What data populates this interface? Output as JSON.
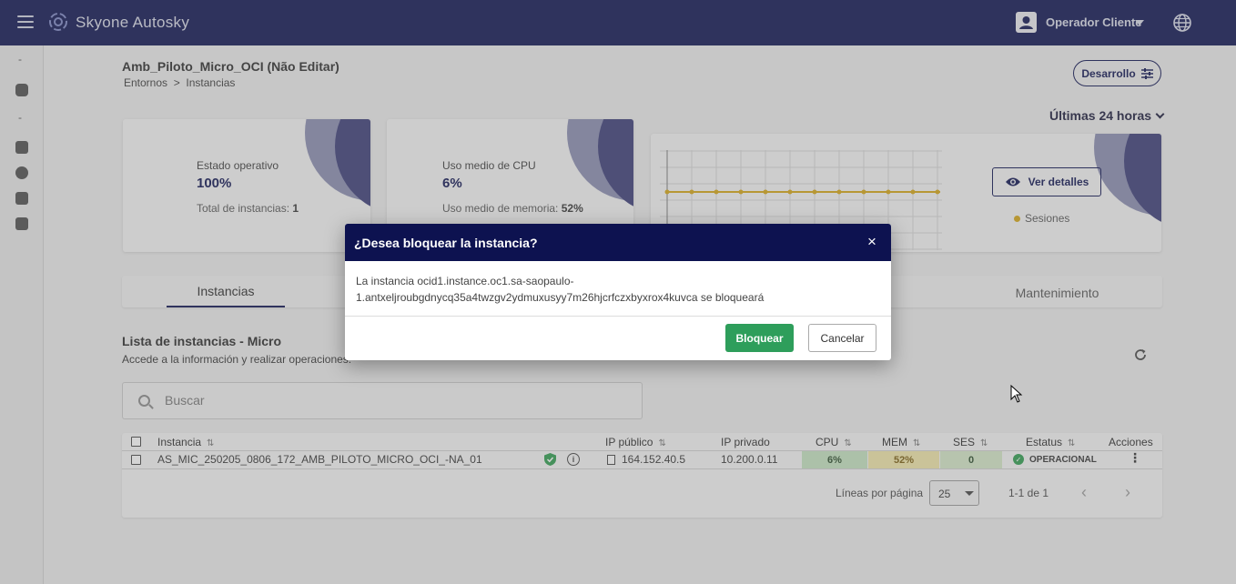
{
  "app": {
    "title": "Skyone Autosky",
    "user_name": "Operador Cliente"
  },
  "page": {
    "title": "Amb_Piloto_Micro_OCI (Não Editar)",
    "breadcrumb": "Entornos  >  Instancias",
    "environment_button": "Desarrollo",
    "period": "Últimas 24 horas"
  },
  "cards": {
    "status": {
      "label": "Estado operativo",
      "value": "100%",
      "sub_label": "Total de instancias:",
      "sub_value": "1"
    },
    "cpu": {
      "label": "Uso medio de CPU",
      "value": "6%",
      "sub_label": "Uso medio de memoria:",
      "sub_value": "52%"
    },
    "sessions": {
      "details_button": "Ver detalles",
      "legend": "Sesiones",
      "series_color": "#d4a615"
    }
  },
  "tabs": [
    {
      "label": "Instancias"
    },
    {
      "label": "Mantenimiento"
    }
  ],
  "list": {
    "title": "Lista de instancias - Micro",
    "subtitle": "Accede a la información y realizar operaciones.",
    "search_placeholder": "Buscar"
  },
  "table": {
    "headers": {
      "instance": "Instancia",
      "public_ip": "IP público",
      "private_ip": "IP privado",
      "cpu": "CPU",
      "mem": "MEM",
      "ses": "SES",
      "status": "Estatus",
      "actions": "Acciones"
    },
    "rows": [
      {
        "instance": "AS_MIC_250205_0806_172_AMB_PILOTO_MICRO_OCI_-NA_01",
        "public_ip": "164.152.40.5",
        "private_ip": "10.200.0.11",
        "cpu": "6%",
        "mem": "52%",
        "ses": "0",
        "status": "OPERACIONAL"
      }
    ],
    "pagination": {
      "rows_label": "Líneas por página",
      "rows_value": "25",
      "range": "1-1 de 1"
    }
  },
  "dialog": {
    "title": "¿Desea bloquear la instancia?",
    "close_glyph": "×",
    "body_line1": "La instancia ocid1.instance.oc1.sa-saopaulo-",
    "body_line2": "1.antxeljroubgdnycq35a4twzgv2ydmuxusyy7m26hjcrfczxbyxrox4kuvca se bloqueará",
    "confirm_button": "Bloquear",
    "cancel_button": "Cancelar"
  },
  "colors": {
    "navy": "#0d1250",
    "success": "#2e9e5b",
    "cpu_cell": "#c5e4c0",
    "mem_cell": "#f0e6a8",
    "ses_cell": "#d4e8c8"
  }
}
